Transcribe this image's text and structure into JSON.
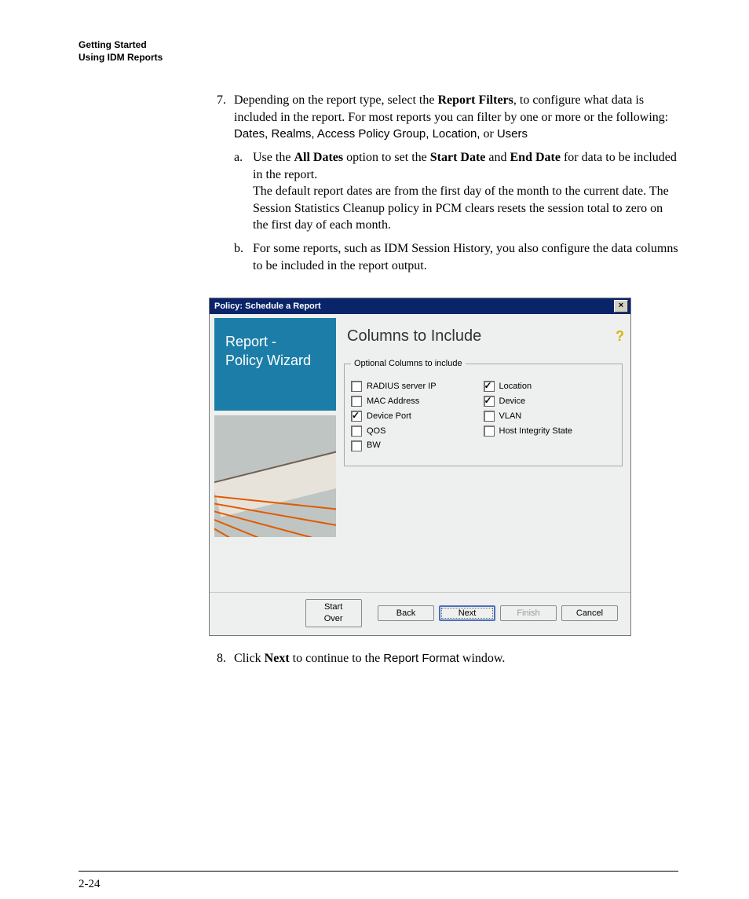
{
  "header": {
    "line1": "Getting Started",
    "line2": "Using IDM Reports"
  },
  "item7": {
    "num": "7.",
    "p1_pre": "Depending on the report type, select the ",
    "p1_bold": "Report Filters",
    "p1_post": ", to configure what data is included in the report. For most reports you can filter by one or more or the following: ",
    "p1_sans": "Dates, Realms, Access Policy Group, Location,",
    "p1_or": " or ",
    "p1_sans2": "Users",
    "a": {
      "marker": "a.",
      "s1_pre": "Use the ",
      "s1_b1": "All Dates",
      "s1_mid1": " option to set the ",
      "s1_b2": "Start Date",
      "s1_mid2": " and ",
      "s1_b3": "End Date",
      "s1_post": " for data to be included in the report.",
      "s2": "The default report dates are from the first day of the month to the current date. The Session Statistics Cleanup policy in PCM clears resets the session total to zero on the first day of each month."
    },
    "b": {
      "marker": "b.",
      "text": "For some reports, such as IDM Session History, you also configure the data columns to be included in the report output."
    }
  },
  "dialog": {
    "title": "Policy: Schedule a Report",
    "close": "×",
    "left_title_1": "Report -",
    "left_title_2": "Policy Wizard",
    "section_title": "Columns to Include",
    "legend": "Optional Columns to include",
    "help": "?",
    "checkboxes": {
      "left": [
        {
          "label": "RADIUS server IP",
          "checked": false
        },
        {
          "label": "MAC Address",
          "checked": false
        },
        {
          "label": "Device Port",
          "checked": true
        },
        {
          "label": "QOS",
          "checked": false
        },
        {
          "label": "BW",
          "checked": false
        }
      ],
      "right": [
        {
          "label": "Location",
          "checked": true
        },
        {
          "label": "Device",
          "checked": true
        },
        {
          "label": "VLAN",
          "checked": false
        },
        {
          "label": "Host Integrity State",
          "checked": false
        }
      ]
    },
    "buttons": {
      "start_over": "Start Over",
      "back": "Back",
      "next": "Next",
      "finish": "Finish",
      "cancel": "Cancel"
    }
  },
  "item8": {
    "num": "8.",
    "pre": "Click ",
    "bold": "Next",
    "mid": " to continue to the ",
    "sans": "Report Format",
    "post": " window."
  },
  "footer": "2-24"
}
